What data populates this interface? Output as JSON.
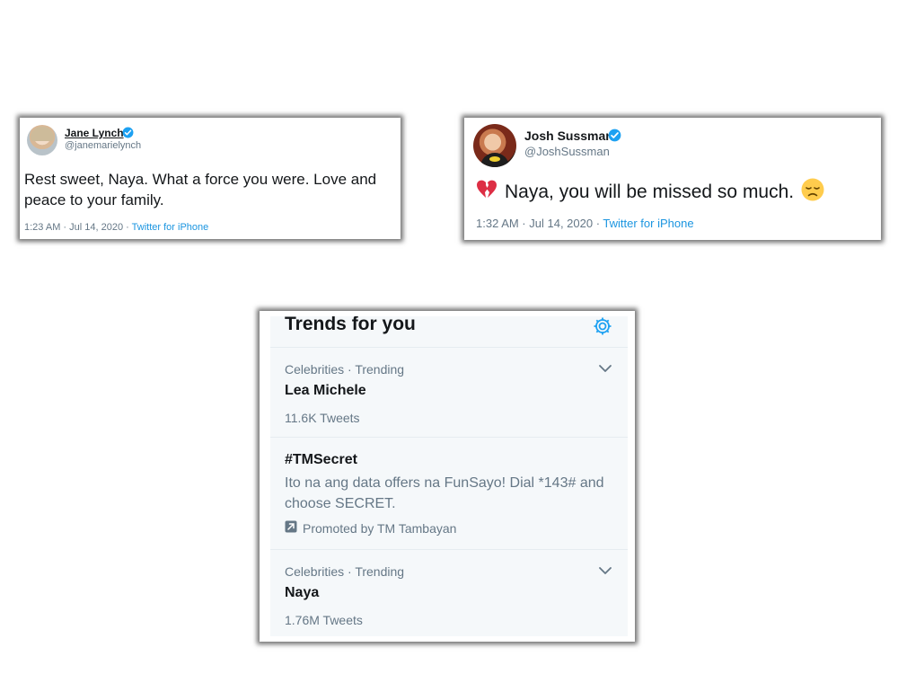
{
  "tweet1": {
    "name": "Jane Lynch",
    "handle": "@janemarielynch",
    "text": "Rest sweet, Naya. What a force you were. Love and peace to your family.",
    "timestamp": "1:23 AM · Jul 14, 2020 · ",
    "source": "Twitter for iPhone"
  },
  "tweet2": {
    "name": "Josh Sussman",
    "handle": "@JoshSussman",
    "text": "Naya, you will be missed so much.",
    "emoji_before": "broken-heart",
    "emoji_after": "disappointed-face",
    "timestamp": "1:32 AM · Jul 14, 2020 · ",
    "source": "Twitter for iPhone"
  },
  "trends": {
    "title": "Trends for you",
    "settings_icon": "gear-icon",
    "items": [
      {
        "category": "Celebrities · Trending",
        "name": "Lea Michele",
        "count": "11.6K Tweets"
      },
      {
        "name": "#TMSecret",
        "description": "Ito na ang data offers na FunSayo! Dial *143# and choose SECRET.",
        "promoted": "Promoted by TM Tambayan"
      },
      {
        "category": "Celebrities · Trending",
        "name": "Naya",
        "count": "1.76M Tweets"
      }
    ]
  },
  "colors": {
    "link": "#1b95e0",
    "verified": "#1da1f2",
    "muted": "#657786",
    "panel_bg": "#f5f8fa"
  }
}
